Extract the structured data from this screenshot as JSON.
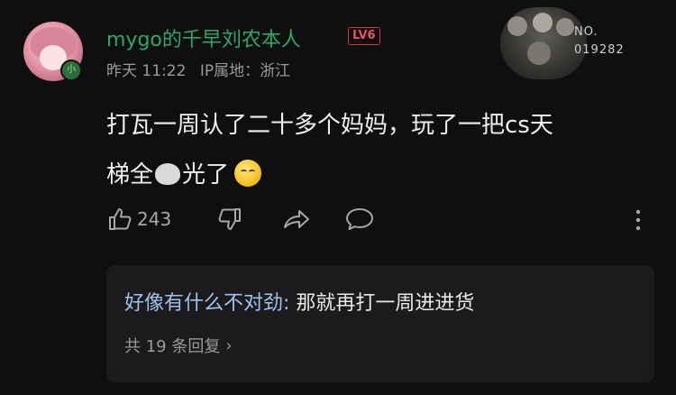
{
  "comment": {
    "username": "mygo的千早刘农本人",
    "level": "LV6",
    "avatar_badge": "小",
    "time": "昨天 11:22",
    "ip_location": "IP属地：浙江",
    "fan_card": {
      "no_label": "NO.",
      "number": "019282"
    },
    "content_line1": "打瓦一周认了二十多个妈妈，玩了一把cs天",
    "content_line2_start": "梯全",
    "content_line2_end": "光了",
    "emoji_icon": "laughing-face-icon",
    "likes": "243"
  },
  "replies": {
    "first_author": "好像有什么不对劲:",
    "first_text": " 那就再打一周进进货",
    "total_label": "共 19 条回复",
    "chevron": "›"
  },
  "colors": {
    "background": "#0f0f10",
    "username": "#2ea66a",
    "level_badge": "#d9364a",
    "reply_author": "#9fc3ea",
    "reply_panel": "#1b1b1d"
  }
}
